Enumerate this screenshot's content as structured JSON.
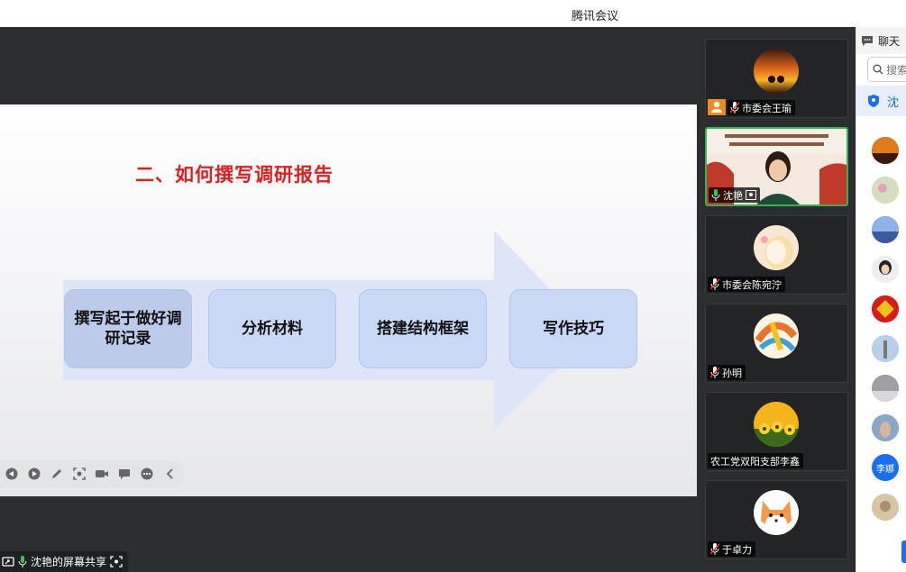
{
  "window": {
    "title": "腾讯会议"
  },
  "slide": {
    "heading": "二、如何撰写调研报告",
    "steps": [
      "撰写起于做好调研记录",
      "分析材料",
      "搭建结构框架",
      "写作技巧"
    ]
  },
  "share_label": "沈艳的屏幕共享",
  "participants": [
    {
      "name": "市委会王瑜"
    },
    {
      "name": "沈艳"
    },
    {
      "name": "市委会陈宛泞"
    },
    {
      "name": "孙明"
    },
    {
      "name": "农工党双阳支部李鑫"
    },
    {
      "name": "于卓力"
    }
  ],
  "chat": {
    "title": "聊天",
    "search_placeholder": "搜索",
    "pinned_name": "沈",
    "avatar_text": "李娜"
  },
  "colors": {
    "accent": "#1a6ff0",
    "heading_red": "#e01e1e",
    "active_border": "#2fb552"
  }
}
